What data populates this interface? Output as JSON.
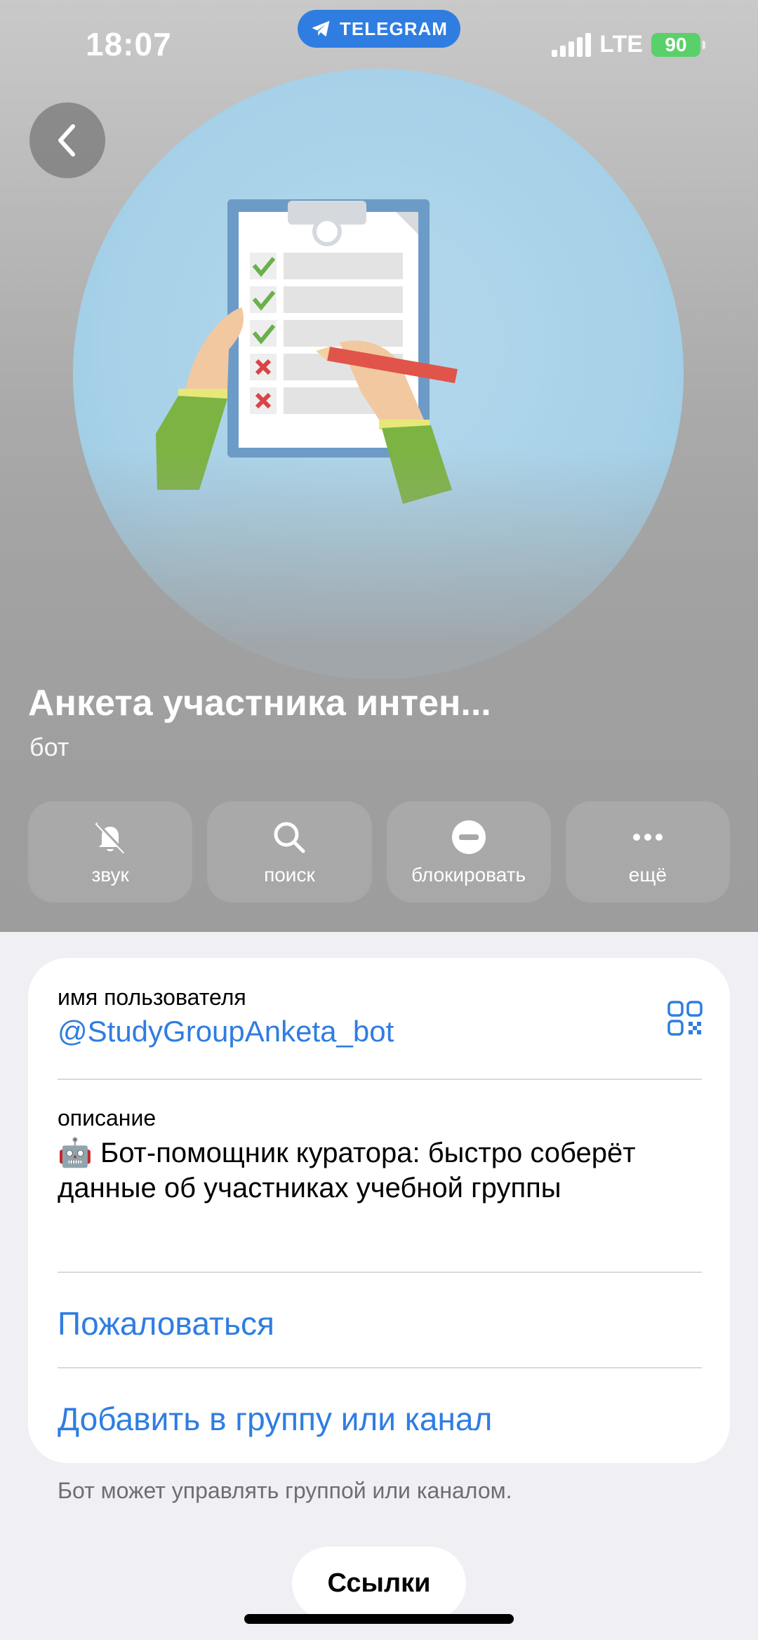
{
  "status": {
    "time": "18:07",
    "app_pill": "TELEGRAM",
    "network": "LTE",
    "battery": "90"
  },
  "profile": {
    "name": "Анкета участника интен...",
    "subtitle": "бот"
  },
  "actions": [
    {
      "label": "звук",
      "icon": "bell-slash-icon"
    },
    {
      "label": "поиск",
      "icon": "search-icon"
    },
    {
      "label": "блокировать",
      "icon": "block-icon"
    },
    {
      "label": "ещё",
      "icon": "more-icon"
    }
  ],
  "info": {
    "username_label": "имя пользователя",
    "username": "@StudyGroupAnketa_bot",
    "description_label": "описание",
    "description_emoji": "🤖",
    "description": "Бот-помощник куратора: быстро соберёт данные об участниках учебной группы",
    "report": "Пожаловаться",
    "add_to_group": "Добавить в группу или канал"
  },
  "footnote": "Бот может управлять группой или каналом.",
  "links_button": "Ссылки",
  "colors": {
    "accent": "#2f7de1",
    "battery": "#5ad06a",
    "background": "#efeff4"
  }
}
